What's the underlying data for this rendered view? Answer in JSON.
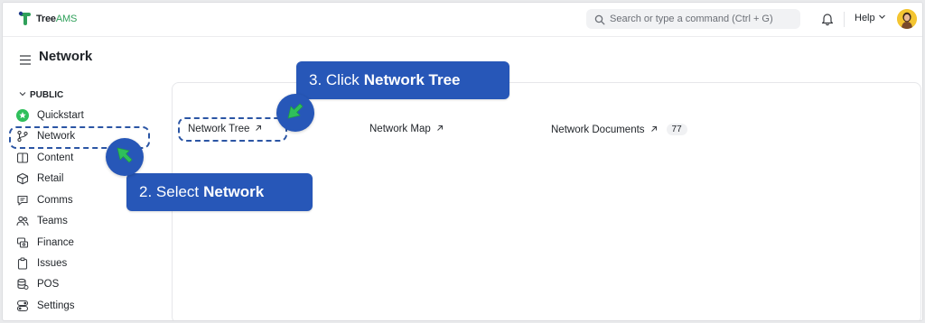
{
  "header": {
    "logo_tree": "Tree",
    "logo_ams": "AMS",
    "search_placeholder": "Search or type a command (Ctrl + G)",
    "help_label": "Help"
  },
  "page": {
    "title": "Network"
  },
  "sidebar": {
    "group_label": "PUBLIC",
    "items": [
      {
        "label": "Quickstart",
        "icon": "star-badge-icon"
      },
      {
        "label": "Network",
        "icon": "git-branch-icon"
      },
      {
        "label": "Content",
        "icon": "book-icon"
      },
      {
        "label": "Retail",
        "icon": "box-icon"
      },
      {
        "label": "Comms",
        "icon": "chat-icon"
      },
      {
        "label": "Teams",
        "icon": "people-icon"
      },
      {
        "label": "Finance",
        "icon": "coins-icon"
      },
      {
        "label": "Issues",
        "icon": "clipboard-icon"
      },
      {
        "label": "POS",
        "icon": "database-icon"
      },
      {
        "label": "Settings",
        "icon": "toggle-icon"
      }
    ]
  },
  "links": {
    "network_tree": "Network Tree",
    "network_map": "Network Map",
    "network_documents": "Network Documents",
    "network_documents_count": "77"
  },
  "callouts": {
    "step2_prefix": "2. Select",
    "step2_bold": "Network",
    "step3_prefix": "3. Click",
    "step3_bold": "Network Tree"
  },
  "colors": {
    "accent_blue": "#2757b8",
    "cursor_green": "#2fbf5b",
    "brand_green": "#2fa05a"
  }
}
